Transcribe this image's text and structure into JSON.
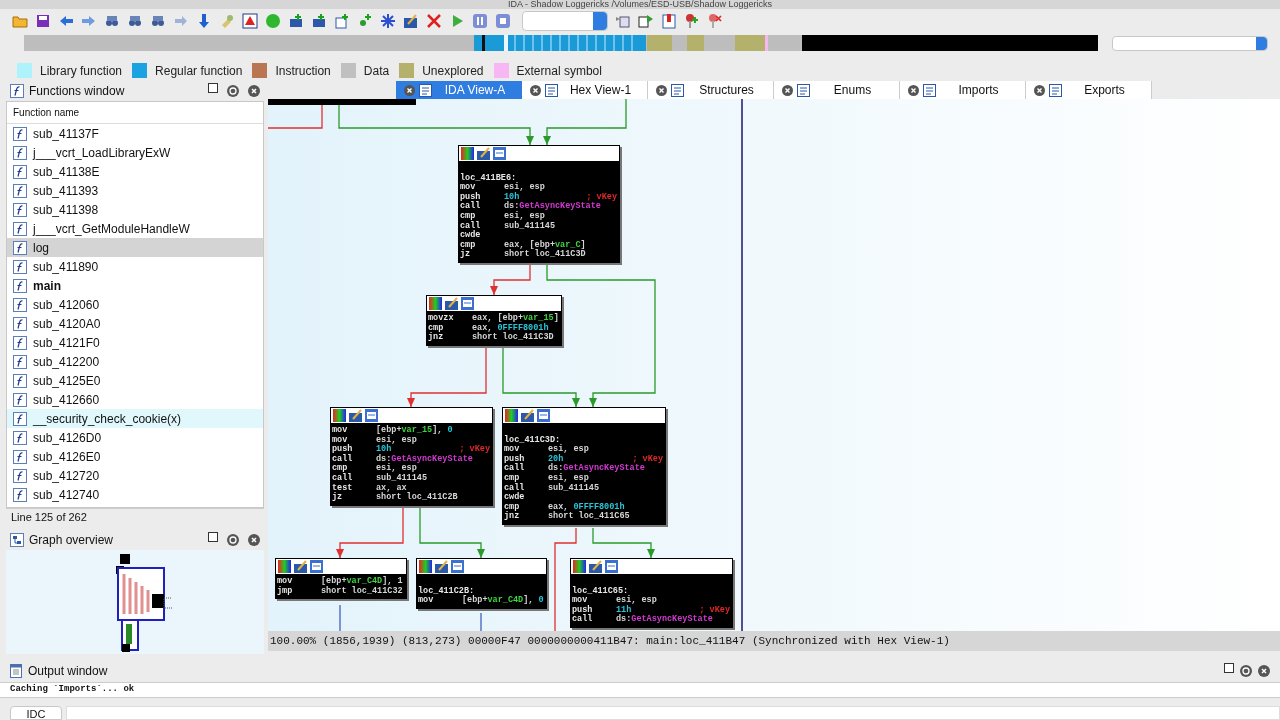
{
  "window": {
    "title": "IDA - Shadow Loggericks /Volumes/ESD-USB/Shadow Loggericks"
  },
  "legend": [
    {
      "label": "Library function",
      "color": "#aef3fb"
    },
    {
      "label": "Regular function",
      "color": "#1aa3e0"
    },
    {
      "label": "Instruction",
      "color": "#b87652"
    },
    {
      "label": "Data",
      "color": "#c0c0c0"
    },
    {
      "label": "Unexplored",
      "color": "#b4b16c"
    },
    {
      "label": "External symbol",
      "color": "#f7b7f2"
    }
  ],
  "functions_window": {
    "title": "Functions window",
    "column": "Function name",
    "items": [
      {
        "name": "sub_41137F",
        "kind": "regular",
        "selected": false
      },
      {
        "name": "j___vcrt_LoadLibraryExW",
        "kind": "regular",
        "selected": false
      },
      {
        "name": "sub_41138E",
        "kind": "regular",
        "selected": false
      },
      {
        "name": "sub_411393",
        "kind": "regular",
        "selected": false
      },
      {
        "name": "sub_411398",
        "kind": "regular",
        "selected": false
      },
      {
        "name": "j___vcrt_GetModuleHandleW",
        "kind": "regular",
        "selected": false
      },
      {
        "name": "log",
        "kind": "regular",
        "selected": true
      },
      {
        "name": "sub_411890",
        "kind": "regular",
        "selected": false
      },
      {
        "name": "main",
        "kind": "main",
        "selected": false
      },
      {
        "name": "sub_412060",
        "kind": "regular",
        "selected": false
      },
      {
        "name": "sub_4120A0",
        "kind": "regular",
        "selected": false
      },
      {
        "name": "sub_4121F0",
        "kind": "regular",
        "selected": false
      },
      {
        "name": "sub_412200",
        "kind": "regular",
        "selected": false
      },
      {
        "name": "sub_4125E0",
        "kind": "regular",
        "selected": false
      },
      {
        "name": "sub_412660",
        "kind": "regular",
        "selected": false
      },
      {
        "name": "__security_check_cookie(x)",
        "kind": "library",
        "selected": false
      },
      {
        "name": "sub_4126D0",
        "kind": "regular",
        "selected": false
      },
      {
        "name": "sub_4126E0",
        "kind": "regular",
        "selected": false
      },
      {
        "name": "sub_412720",
        "kind": "regular",
        "selected": false
      },
      {
        "name": "sub_412740",
        "kind": "regular",
        "selected": false
      }
    ],
    "status": "Line 125 of 262"
  },
  "graph_overview": {
    "title": "Graph overview"
  },
  "tabs": [
    {
      "label": "IDA View-A",
      "selected": true
    },
    {
      "label": "Hex View-1",
      "selected": false
    },
    {
      "label": "Structures",
      "selected": false
    },
    {
      "label": "Enums",
      "selected": false
    },
    {
      "label": "Imports",
      "selected": false
    },
    {
      "label": "Exports",
      "selected": false
    }
  ],
  "graph": {
    "nodes": [
      {
        "lines": [
          {
            "label": "loc_411BE6:"
          },
          {
            "op": "mov",
            "args": [
              {
                "text": "esi, esp",
                "kind": "plain"
              }
            ]
          },
          {
            "op": "push",
            "args": [
              {
                "text": "10h",
                "kind": "num"
              }
            ],
            "comment": "; vKey"
          },
          {
            "op": "call",
            "args": [
              {
                "text": "ds:",
                "kind": "plain"
              },
              {
                "text": "GetAsyncKeyState",
                "kind": "api"
              }
            ]
          },
          {
            "op": "cmp",
            "args": [
              {
                "text": "esi, esp",
                "kind": "plain"
              }
            ]
          },
          {
            "op": "call",
            "args": [
              {
                "text": "sub_411145",
                "kind": "plain"
              }
            ]
          },
          {
            "op": "cwde"
          },
          {
            "op": "cmp",
            "args": [
              {
                "text": "eax, [ebp+",
                "kind": "plain"
              },
              {
                "text": "var_C",
                "kind": "var"
              },
              {
                "text": "]",
                "kind": "plain"
              }
            ]
          },
          {
            "op": "jz",
            "args": [
              {
                "text": "short loc_411C3D",
                "kind": "plain"
              }
            ]
          }
        ]
      },
      {
        "lines": [
          {
            "op": "movzx",
            "args": [
              {
                "text": "eax, [ebp+",
                "kind": "plain"
              },
              {
                "text": "var_15",
                "kind": "var"
              },
              {
                "text": "]",
                "kind": "plain"
              }
            ]
          },
          {
            "op": "cmp",
            "args": [
              {
                "text": "eax, ",
                "kind": "plain"
              },
              {
                "text": "0FFFF8001h",
                "kind": "num"
              }
            ]
          },
          {
            "op": "jnz",
            "args": [
              {
                "text": "short loc_411C3D",
                "kind": "plain"
              }
            ]
          }
        ]
      },
      {
        "lines": [
          {
            "op": "mov",
            "args": [
              {
                "text": "[ebp+",
                "kind": "plain"
              },
              {
                "text": "var_15",
                "kind": "var"
              },
              {
                "text": "], ",
                "kind": "plain"
              },
              {
                "text": "0",
                "kind": "num"
              }
            ]
          },
          {
            "op": "mov",
            "args": [
              {
                "text": "esi, esp",
                "kind": "plain"
              }
            ]
          },
          {
            "op": "push",
            "args": [
              {
                "text": "10h",
                "kind": "num"
              }
            ],
            "comment": "; vKey"
          },
          {
            "op": "call",
            "args": [
              {
                "text": "ds:",
                "kind": "plain"
              },
              {
                "text": "GetAsyncKeyState",
                "kind": "api"
              }
            ]
          },
          {
            "op": "cmp",
            "args": [
              {
                "text": "esi, esp",
                "kind": "plain"
              }
            ]
          },
          {
            "op": "call",
            "args": [
              {
                "text": "sub_411145",
                "kind": "plain"
              }
            ]
          },
          {
            "op": "test",
            "args": [
              {
                "text": "ax, ax",
                "kind": "plain"
              }
            ]
          },
          {
            "op": "jz",
            "args": [
              {
                "text": "short loc_411C2B",
                "kind": "plain"
              }
            ]
          }
        ]
      },
      {
        "lines": [
          {
            "label": "loc_411C3D:"
          },
          {
            "op": "mov",
            "args": [
              {
                "text": "esi, esp",
                "kind": "plain"
              }
            ]
          },
          {
            "op": "push",
            "args": [
              {
                "text": "20h",
                "kind": "num"
              }
            ],
            "comment": "; vKey"
          },
          {
            "op": "call",
            "args": [
              {
                "text": "ds:",
                "kind": "plain"
              },
              {
                "text": "GetAsyncKeyState",
                "kind": "api"
              }
            ]
          },
          {
            "op": "cmp",
            "args": [
              {
                "text": "esi, esp",
                "kind": "plain"
              }
            ]
          },
          {
            "op": "call",
            "args": [
              {
                "text": "sub_411145",
                "kind": "plain"
              }
            ]
          },
          {
            "op": "cwde"
          },
          {
            "op": "cmp",
            "args": [
              {
                "text": "eax, ",
                "kind": "plain"
              },
              {
                "text": "0FFFF8001h",
                "kind": "num"
              }
            ]
          },
          {
            "op": "jnz",
            "args": [
              {
                "text": "short loc_411C65",
                "kind": "plain"
              }
            ]
          }
        ]
      },
      {
        "lines": [
          {
            "op": "mov",
            "args": [
              {
                "text": "[ebp+",
                "kind": "plain"
              },
              {
                "text": "var_C4D",
                "kind": "var"
              },
              {
                "text": "], 1",
                "kind": "plain"
              }
            ]
          },
          {
            "op": "jmp",
            "args": [
              {
                "text": "short loc_411C32",
                "kind": "plain"
              }
            ]
          }
        ]
      },
      {
        "lines": [
          {
            "label": "loc_411C2B:"
          },
          {
            "op": "mov",
            "args": [
              {
                "text": "[ebp+",
                "kind": "plain"
              },
              {
                "text": "var_C4D",
                "kind": "var"
              },
              {
                "text": "], ",
                "kind": "plain"
              },
              {
                "text": "0",
                "kind": "num"
              }
            ]
          }
        ]
      },
      {
        "lines": [
          {
            "label": "loc_411C65:"
          },
          {
            "op": "mov",
            "args": [
              {
                "text": "esi, esp",
                "kind": "plain"
              }
            ]
          },
          {
            "op": "push",
            "args": [
              {
                "text": "11h",
                "kind": "num"
              }
            ],
            "comment": "; vKey"
          },
          {
            "op": "call",
            "args": [
              {
                "text": "ds:",
                "kind": "plain"
              },
              {
                "text": "GetAsyncKeyState",
                "kind": "api"
              }
            ]
          }
        ]
      }
    ]
  },
  "graph_status": "100.00% (1856,1939) (813,273) 00000F47 0000000000411B47: main:loc_411B47 (Synchronized with Hex View-1)",
  "output_window": {
    "title": "Output window",
    "lines": [
      "Caching `Imports`... ok"
    ],
    "command_button": "IDC"
  }
}
